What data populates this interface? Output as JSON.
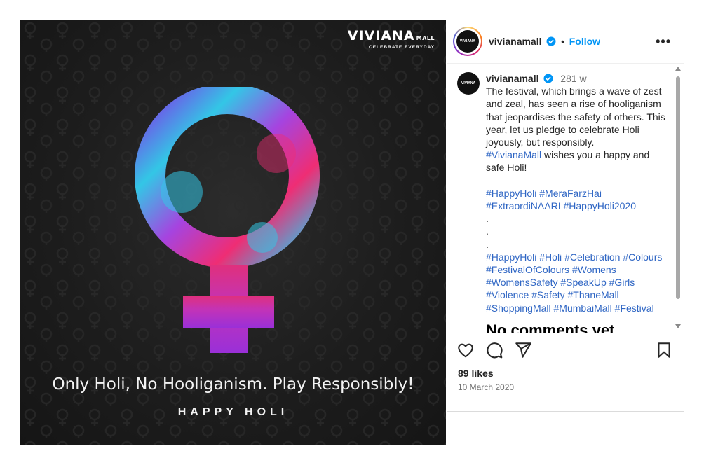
{
  "image": {
    "brand_name": "VIVIANA",
    "brand_suffix": "MALL",
    "brand_tagline": "CELEBRATE EVERYDAY",
    "headline": "Only Holi, No Hooliganism. Play Responsibly!",
    "subline": "HAPPY HOLI",
    "symbol_icon": "venus-symbol-icon",
    "colors": {
      "background": "#1d1d1d",
      "cyan": "#2ec4e8",
      "pink": "#ec2b7a",
      "purple": "#9b2fd6"
    }
  },
  "header": {
    "avatar_text": "VIVIANA",
    "username": "vivianamall",
    "verified_icon": "verified-badge-icon",
    "separator": "•",
    "follow_label": "Follow",
    "more_label": "•••"
  },
  "caption": {
    "avatar_text": "VIVIANA",
    "username": "vivianamall",
    "time_ago": "281 w",
    "text": "The festival, which brings a wave of zest and zeal, has seen a rise of hooliganism that jeopardises the safety of others. This year, let us pledge to celebrate Holi joyously, but responsibly.",
    "mention_tag": "#VivianaMall",
    "wish_text": "wishes you a happy and safe Holi!",
    "tags_group1": [
      "#HappyHoli",
      "#MeraFarzHai",
      "#ExtraordiNAARI",
      "#HappyHoli2020"
    ],
    "dots": [
      ".",
      ".",
      "."
    ],
    "tags_group2": [
      "#HappyHoli",
      "#Holi",
      "#Celebration",
      "#Colours",
      "#FestivalOfColours",
      "#Womens",
      "#WomensSafety",
      "#SpeakUp",
      "#Girls",
      "#Violence",
      "#Safety",
      "#ThaneMall",
      "#ShoppingMall",
      "#MumbaiMall",
      "#Festival"
    ]
  },
  "comments": {
    "empty_label": "No comments yet."
  },
  "actions": {
    "like_icon": "heart-icon",
    "comment_icon": "comment-icon",
    "share_icon": "share-icon",
    "save_icon": "bookmark-icon"
  },
  "likes": "89 likes",
  "date": "10 March 2020",
  "colors": {
    "link": "#0095f6",
    "hashtag": "#2f66c4",
    "muted": "#737373",
    "text": "#262626"
  }
}
